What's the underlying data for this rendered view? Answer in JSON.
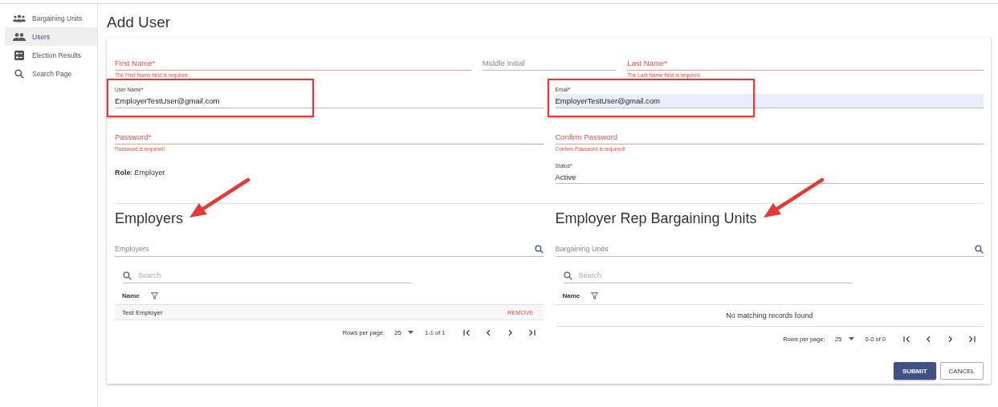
{
  "sidebar": {
    "items": [
      {
        "label": "Bargaining Units",
        "selected": false
      },
      {
        "label": "Users",
        "selected": true
      },
      {
        "label": "Election Results",
        "selected": false
      },
      {
        "label": "Search Page",
        "selected": false
      }
    ]
  },
  "title": "Add User",
  "form": {
    "rows": [
      {
        "fields": [
          {
            "label": "First Name*",
            "error": "The First Name field is required.",
            "invalid": true
          },
          {
            "label": "Middle Initial",
            "invalid": false
          },
          {
            "label": "Last Name*",
            "error": "The Last Name field is required.",
            "invalid": true
          }
        ]
      },
      {
        "fields": [
          {
            "label": "User Name*",
            "value": "EmployerTestUser@gmail.com",
            "invalid": false,
            "autofilled": false,
            "highlighted": true
          },
          {
            "label": "Email*",
            "value": "EmployerTestUser@gmail.com",
            "invalid": false,
            "autofilled": true,
            "highlighted": true
          }
        ]
      },
      {
        "fields": [
          {
            "label": "Password*",
            "error": "Password is required!",
            "invalid": true
          },
          {
            "label": "Confirm Password",
            "error": "Confirm Password is required!",
            "invalid": true
          }
        ]
      }
    ],
    "role": "**Role**: Employer",
    "status": {
      "label": "Status*",
      "value": "Active"
    }
  },
  "sections": [
    {
      "title": "Employers",
      "arrow": true,
      "picker_label": "Employers",
      "search_placeholder": "Search",
      "column": "Name",
      "rows": [
        {
          "name": "Test Employer",
          "action": "REMOVE"
        }
      ],
      "rows_per_page_label": "Rows per page:",
      "rows_per_page": "25",
      "range": "1-1 of 1"
    },
    {
      "title": "Employer Rep Bargaining Units",
      "arrow": true,
      "picker_label": "Bargaining Units",
      "search_placeholder": "Search",
      "column": "Name",
      "empty_text": "No matching records found",
      "rows_per_page_label": "Rows per page:",
      "rows_per_page": "25",
      "range": "0-0 of 0"
    }
  ],
  "buttons": [
    {
      "label": "SUBMIT",
      "kind": "primary"
    },
    {
      "label": "CANCEL",
      "kind": "outlined"
    }
  ]
}
